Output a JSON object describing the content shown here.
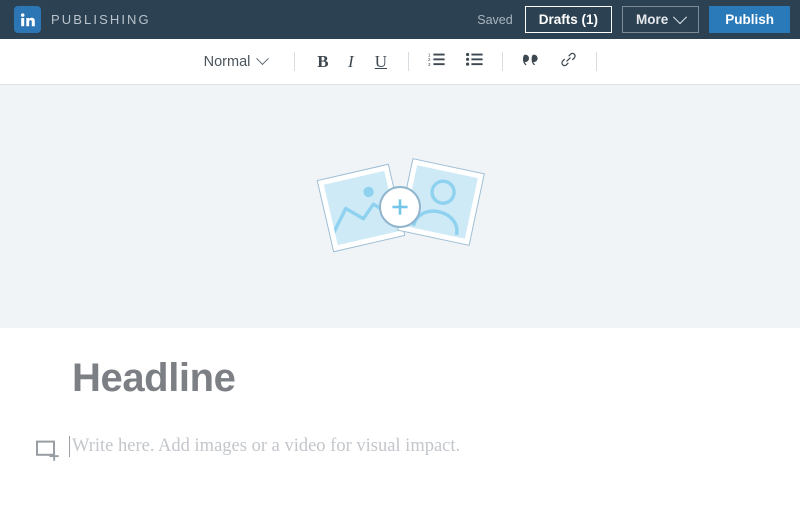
{
  "header": {
    "logo_icon": "linkedin-logo",
    "brand": "PUBLISHING",
    "status": "Saved",
    "drafts_label": "Drafts (1)",
    "more_label": "More",
    "more_caret_icon": "chevron-down-icon",
    "publish_label": "Publish",
    "bg_color": "#2c4152",
    "publish_color": "#2a7ab9"
  },
  "toolbar": {
    "style_label": "Normal",
    "style_caret_icon": "chevron-down-icon",
    "bold_label": "B",
    "italic_label": "I",
    "underline_label": "U",
    "ordered_list_icon": "ordered-list-icon",
    "unordered_list_icon": "bulleted-list-icon",
    "quote_icon": "quote-icon",
    "link_icon": "link-icon"
  },
  "hero": {
    "art_icon": "add-photos-illustration",
    "plus_icon": "plus-icon",
    "left_card_icon": "landscape-photo-icon",
    "right_card_icon": "person-photo-icon",
    "bg_color": "#f0f4f7"
  },
  "article": {
    "headline_placeholder": "Headline",
    "add_media_icon": "add-media-icon",
    "body_placeholder": "Write here. Add images or a video for visual impact."
  }
}
